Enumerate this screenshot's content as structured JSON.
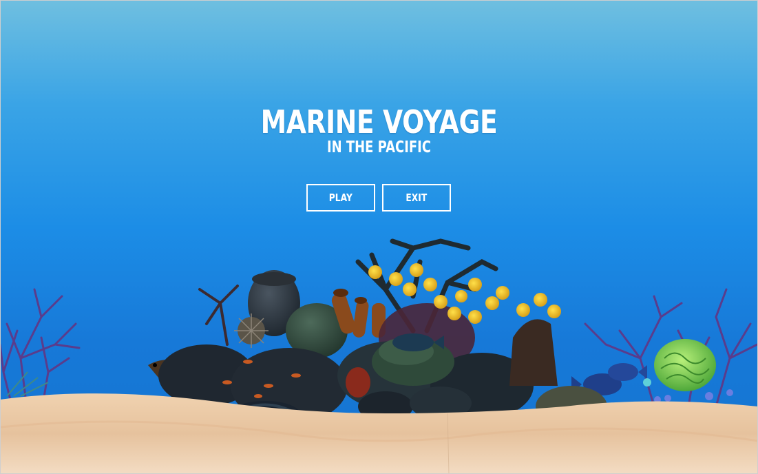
{
  "game": {
    "title": "Marine Voyage",
    "subtitle": "In the Pacific"
  },
  "menu": {
    "play_label": "Play",
    "exit_label": "Exit"
  },
  "colors": {
    "water_top": "#6fbfe0",
    "water_mid": "#1c8de6",
    "water_bottom": "#1474d0",
    "sand": "#e9c9a6",
    "button_border": "#ffffff",
    "title_text": "#ffffff"
  },
  "scene": {
    "elements": [
      "coral-reef",
      "purple-sea-fan",
      "sea-sponge",
      "brain-coral",
      "yellow-butterflyfish-school",
      "blue-tang-fish",
      "moray-eel",
      "sea-urchin",
      "giant-clam",
      "sandy-seabed"
    ]
  }
}
